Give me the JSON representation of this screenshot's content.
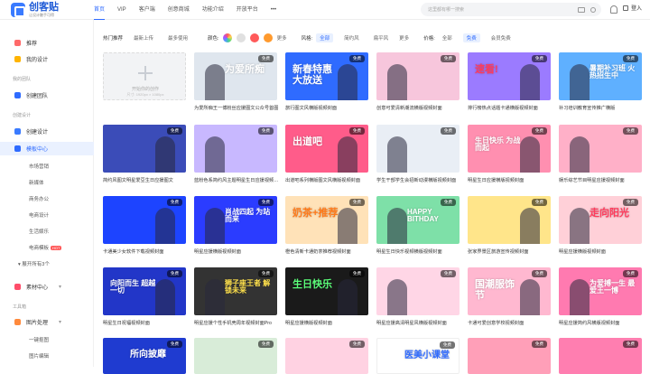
{
  "brand": {
    "name": "创客贴",
    "slogan": "让设计触手可得"
  },
  "nav": [
    "首页",
    "VIP",
    "客户端",
    "创意商城",
    "功能介绍",
    "开放平台",
    "•••"
  ],
  "search": {
    "placeholder": "这里都有哪一搜索"
  },
  "login": "登入",
  "sidebar": {
    "items": [
      {
        "label": "推荐",
        "color": "#ff6a6a"
      },
      {
        "label": "我的设计",
        "color": "#ffb400"
      }
    ],
    "section_mine": "我的团队",
    "create_team": "创建团队",
    "section_create": "创建设计",
    "create_design": "创建设计",
    "template_center": "模板中心",
    "subs": [
      "市场营销",
      "新媒体",
      "商务办公",
      "电商设计",
      "生活娱乐",
      "电商模板"
    ],
    "hot": "HOT",
    "expand": "展开所有3个",
    "material": "素材中心",
    "section_tools": "工具箱",
    "image_tools": "图片处理",
    "tool_subs": [
      "一键抠图",
      "图片编辑"
    ]
  },
  "filters": {
    "sort_label": "热门推荐",
    "sort_opts": [
      "最新上传",
      "最多使用"
    ],
    "color_label": "颜色:",
    "colors": [
      "#e0e0e0",
      "#ff5a5a",
      "#ff9a2e"
    ],
    "more": "更多",
    "style_label": "风格:",
    "style_opts": [
      "全部",
      "简约风",
      "扁平风"
    ],
    "price_label": "价格:",
    "price_opts": [
      "全部",
      "免费",
      "会员免费"
    ]
  },
  "add_card": {
    "title": "开始你的创作",
    "sub": "尺寸: 1920px × 1080px"
  },
  "cards": [
    {
      "cap": "为爱所痴王一博粉丝应援图文公众号首图",
      "bg": "#dfe6ee",
      "text": "为爱所痴",
      "tc": "#ffffff",
      "badge": "免费"
    },
    {
      "cap": "旅行图文风横版视频封面",
      "bg": "#2f6bff",
      "text": "新春特惠 大放送",
      "tc": "#ffffff",
      "badge": "免费"
    },
    {
      "cap": "创意可爱清新潮流横版视频封面",
      "bg": "#f7c6dc",
      "text": "",
      "tc": "#ffffff",
      "badge": "免费"
    },
    {
      "cap": "排行榜热点话题卡通横版视频封面",
      "bg": "#9b7bff",
      "text": "速看!",
      "tc": "#ff3b5c",
      "badge": "免费"
    },
    {
      "cap": "补习培训教育宣传推广横版",
      "bg": "#5fb0ff",
      "text": "暑期补习班 火热招生中",
      "tc": "#ffffff",
      "badge": "免费"
    },
    {
      "cap": "简约风图文明星爱豆生日应援图文",
      "bg": "#3b4cb8",
      "text": "",
      "tc": "#ffffff",
      "badge": "免费"
    },
    {
      "cap": "蓝粉色系简约风主题明星生日应援视频封面",
      "bg": "#c8b8ff",
      "text": "",
      "tc": "#ffffff",
      "badge": "免费"
    },
    {
      "cap": "出道吧系列横版图文风横版视频封面",
      "bg": "#ff5c8a",
      "text": "出道吧",
      "tc": "#ffffff",
      "badge": "免费"
    },
    {
      "cap": "学生干部学生会招新动漫横版视频封面",
      "bg": "#e9eef5",
      "text": "",
      "tc": "#333333",
      "badge": "免费"
    },
    {
      "cap": "明星生日应援横版视频封面",
      "bg": "#ff8fb0",
      "text": "生日快乐 为战而起",
      "tc": "#ffffff",
      "badge": "免费"
    },
    {
      "cap": "娱乐综艺节目明星应援视频封面",
      "bg": "#ffb0c8",
      "text": "",
      "tc": "#ffffff",
      "badge": "免费"
    },
    {
      "cap": "卡通美少女软件下载视频封面",
      "bg": "#1d44ff",
      "text": "",
      "tc": "#ffffff",
      "badge": "免费"
    },
    {
      "cap": "明星应援横版视频封面",
      "bg": "#2b3cff",
      "text": "肖战四起 为站而来",
      "tc": "#ffffff",
      "badge": "免费"
    },
    {
      "cap": "橙色清新卡通奶茶推荐视频封面",
      "bg": "#ffe2b8",
      "text": "奶茶+推荐",
      "tc": "#ff7a1a",
      "badge": "免费"
    },
    {
      "cap": "明星生日快乐视频横版视频封面",
      "bg": "#7ee0a8",
      "text": "HAPPY BITHDAY",
      "tc": "#ffffff",
      "badge": "免费"
    },
    {
      "cap": "张家界景区旅游宣传视频封面",
      "bg": "#ffe58a",
      "text": "",
      "tc": "#333333",
      "badge": "免费"
    },
    {
      "cap": "明星应援横版视频封面",
      "bg": "#ffd0d8",
      "text": "走向阳光",
      "tc": "#ff3b5c",
      "badge": "免费"
    },
    {
      "cap": "明星生日祝福视频封面",
      "bg": "#2236c8",
      "text": "向阳而生 超越一切",
      "tc": "#ffffff",
      "badge": "免费"
    },
    {
      "cap": "明星应援个性手机壳周年视频封面Pro",
      "bg": "#333333",
      "text": "狮子座王者 解锁未来",
      "tc": "#ffe14d",
      "badge": "免费"
    },
    {
      "cap": "明星应援横版视频封面",
      "bg": "#1a1a1a",
      "text": "生日快乐",
      "tc": "#5cff7a",
      "badge": "免费"
    },
    {
      "cap": "明星应援高清明星风横版视频封面",
      "bg": "#ffd6e6",
      "text": "",
      "tc": "#ffffff",
      "badge": "免费"
    },
    {
      "cap": "卡通可爱创意学校视频封面",
      "bg": "#ffb8d0",
      "text": "国潮服饰节",
      "tc": "#ffffff",
      "badge": "免费"
    },
    {
      "cap": "明星应援简约风横版视频封面",
      "bg": "#ff7ab0",
      "text": "为爱搏一生 最爱王一博",
      "tc": "#ffffff",
      "badge": "免费"
    }
  ],
  "row5": [
    {
      "bg": "#1f3bd0",
      "text": "所向披靡",
      "badge": "免费"
    },
    {
      "bg": "#d8ecd8",
      "text": "",
      "badge": "免费"
    },
    {
      "bg": "#ffd2e2",
      "text": "",
      "badge": "免费"
    },
    {
      "bg": "#ffffff",
      "text": "医美小课堂",
      "badge": "免费"
    },
    {
      "bg": "#ff9fb8",
      "text": "",
      "badge": "免费"
    },
    {
      "bg": "#ff7eb0",
      "text": "",
      "badge": "免费"
    }
  ]
}
